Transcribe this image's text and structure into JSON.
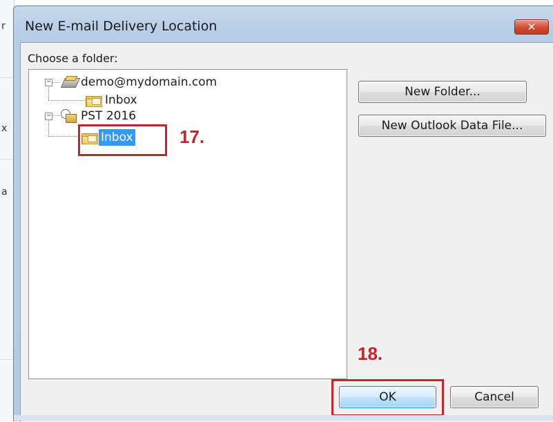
{
  "background_fragments": [
    "r",
    "x",
    "a"
  ],
  "dialog": {
    "title": "New E-mail Delivery Location",
    "close_glyph": "✕",
    "choose_label": "Choose a folder:"
  },
  "tree": {
    "items": [
      {
        "label": "demo@mydomain.com",
        "icon": "account-icon",
        "expander": "−"
      },
      {
        "label": "Inbox",
        "icon": "inbox-folder-icon"
      },
      {
        "label": "PST 2016",
        "icon": "pst-data-file-icon",
        "expander": "−"
      },
      {
        "label": "Inbox",
        "icon": "inbox-folder-icon",
        "selected": true
      }
    ]
  },
  "buttons": {
    "new_folder": "New Folder...",
    "new_data_file": "New Outlook Data File...",
    "ok": "OK",
    "cancel": "Cancel"
  },
  "annotations": {
    "step17": "17.",
    "step18": "18.",
    "color": "#c0262b"
  },
  "colors": {
    "selection": "#3399ff",
    "title_bar": "#b6cde6",
    "close_button": "#cf4b32"
  }
}
